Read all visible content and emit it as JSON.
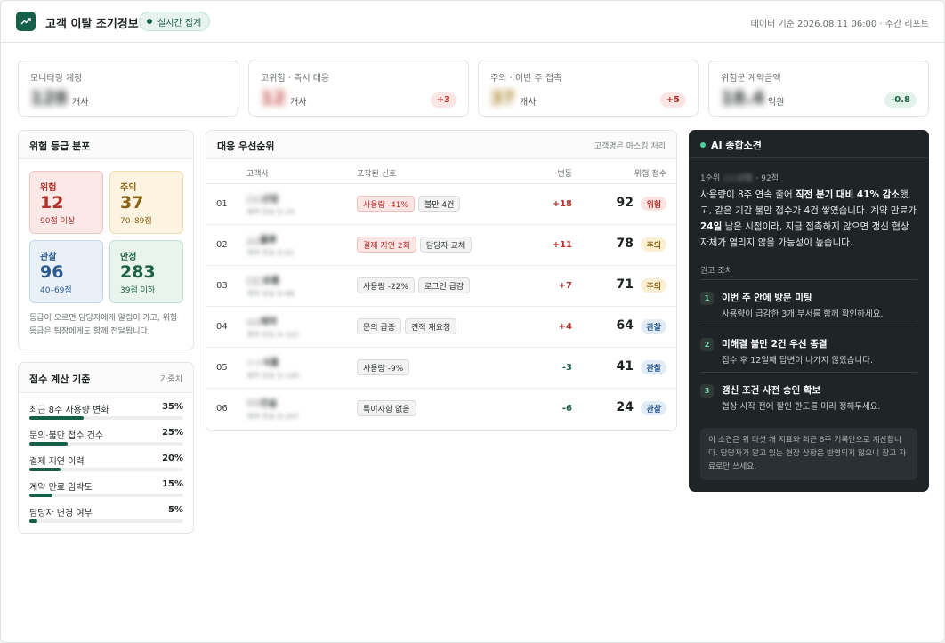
{
  "header": {
    "title": "고객 이탈 조기경보",
    "live_badge": "실시간 집계",
    "data_stamp": "데이터 기준 2026.08.11 06:00 · 주간 리포트"
  },
  "kpis": [
    {
      "label": "모니터링 계정",
      "value": "128",
      "unit": "개사",
      "delta": ""
    },
    {
      "label": "고위험 · 즉시 대응",
      "value": "12",
      "unit": "개사",
      "delta": "+3"
    },
    {
      "label": "주의 · 이번 주 접촉",
      "value": "37",
      "unit": "개사",
      "delta": "+5"
    },
    {
      "label": "위험군 계약금액",
      "value": "18.4",
      "unit": "억원",
      "delta": "-0.8"
    }
  ],
  "distribution": {
    "title": "위험 등급 분포",
    "tiles": [
      {
        "name": "위험",
        "count": "12",
        "range": "90점 이상"
      },
      {
        "name": "주의",
        "count": "37",
        "range": "70–89점"
      },
      {
        "name": "관찰",
        "count": "96",
        "range": "40–69점"
      },
      {
        "name": "안정",
        "count": "283",
        "range": "39점 이하"
      }
    ],
    "note": "등급이 오르면 담당자에게 알림이 가고, 위험 등급은 팀장에게도 함께 전달됩니다."
  },
  "weights": {
    "title": "점수 계산 기준",
    "aside": "가중치",
    "items": [
      {
        "label": "최근 8주 사용량 변화",
        "pct": "35%",
        "value": 35
      },
      {
        "label": "문의·불만 접수 건수",
        "pct": "25%",
        "value": 25
      },
      {
        "label": "결제 지연 이력",
        "pct": "20%",
        "value": 20
      },
      {
        "label": "계약 만료 임박도",
        "pct": "15%",
        "value": 15
      },
      {
        "label": "담당자 변경 여부",
        "pct": "5%",
        "value": 5
      }
    ]
  },
  "priority": {
    "title": "대응 우선순위",
    "aside": "고객명은 마스킹 처리",
    "columns": {
      "company": "고객사",
      "signals": "포착된 신호",
      "change": "변동",
      "score": "위험 점수"
    },
    "rows": [
      {
        "rank": "01",
        "name": "○○산업",
        "meta": "계약 만료 D-24",
        "signals": [
          {
            "text": "사용량 -41%",
            "kind": "alert"
          },
          {
            "text": "불만 4건",
            "kind": "neutral"
          }
        ],
        "change": "+18",
        "dir": "pos",
        "score": "92",
        "grade": "위험",
        "grade_kind": "danger"
      },
      {
        "rank": "02",
        "name": "△△물류",
        "meta": "계약 만료 D-61",
        "signals": [
          {
            "text": "결제 지연 2회",
            "kind": "alert"
          },
          {
            "text": "담당자 교체",
            "kind": "neutral"
          }
        ],
        "change": "+11",
        "dir": "pos",
        "score": "78",
        "grade": "주의",
        "grade_kind": "caution"
      },
      {
        "rank": "03",
        "name": "□□유통",
        "meta": "계약 만료 D-88",
        "signals": [
          {
            "text": "사용량 -22%",
            "kind": "neutral"
          },
          {
            "text": "로그인 급감",
            "kind": "neutral"
          }
        ],
        "change": "+7",
        "dir": "pos",
        "score": "71",
        "grade": "주의",
        "grade_kind": "caution"
      },
      {
        "rank": "04",
        "name": "◇◇제약",
        "meta": "계약 만료 D-102",
        "signals": [
          {
            "text": "문의 급증",
            "kind": "neutral"
          },
          {
            "text": "견적 재요청",
            "kind": "neutral"
          }
        ],
        "change": "+4",
        "dir": "pos",
        "score": "64",
        "grade": "관찰",
        "grade_kind": "watch"
      },
      {
        "rank": "05",
        "name": "☆☆식품",
        "meta": "계약 만료 D-140",
        "signals": [
          {
            "text": "사용량 -9%",
            "kind": "neutral"
          }
        ],
        "change": "-3",
        "dir": "neg",
        "score": "41",
        "grade": "관찰",
        "grade_kind": "watch"
      },
      {
        "rank": "06",
        "name": "▽▽건설",
        "meta": "계약 만료 D-207",
        "signals": [
          {
            "text": "특이사항 없음",
            "kind": "neutral"
          }
        ],
        "change": "-6",
        "dir": "neg",
        "score": "24",
        "grade": "관찰",
        "grade_kind": "watch"
      }
    ]
  },
  "ai": {
    "title": "AI 종합소견",
    "meta_rank": "1순위",
    "meta_name": "○○산업",
    "meta_score": "· 92점",
    "body_1": "사용량이 8주 연속 줄어 ",
    "body_b1": "직전 분기 대비 41% 감소",
    "body_2": "했고, 같은 기간 불만 접수가 4건 쌓였습니다. 계약 만료가 ",
    "body_b2": "24일",
    "body_3": " 남은 시점이라, 지금 접촉하지 않으면 갱신 협상 자체가 열리지 않을 가능성이 높습니다.",
    "sub": "권고 조치",
    "actions": [
      {
        "num": "1",
        "title": "이번 주 안에 방문 미팅",
        "desc": "사용량이 급감한 3개 부서를 함께 확인하세요."
      },
      {
        "num": "2",
        "title": "미해결 불만 2건 우선 종결",
        "desc": "접수 후 12일째 답변이 나가지 않았습니다."
      },
      {
        "num": "3",
        "title": "갱신 조건 사전 승인 확보",
        "desc": "협상 시작 전에 할인 한도를 미리 정해두세요."
      }
    ],
    "foot": "이 소견은 위 다섯 개 지표와 최근 8주 기록만으로 계산합니다. 담당자가 알고 있는 현장 상황은 반영되지 않으니 참고 자료로만 쓰세요."
  },
  "colors": {
    "brand": "#16604a",
    "danger": "#b3322c",
    "caution": "#8a6414",
    "watch": "#2c5a91",
    "ai_bg": "#1f2427"
  }
}
